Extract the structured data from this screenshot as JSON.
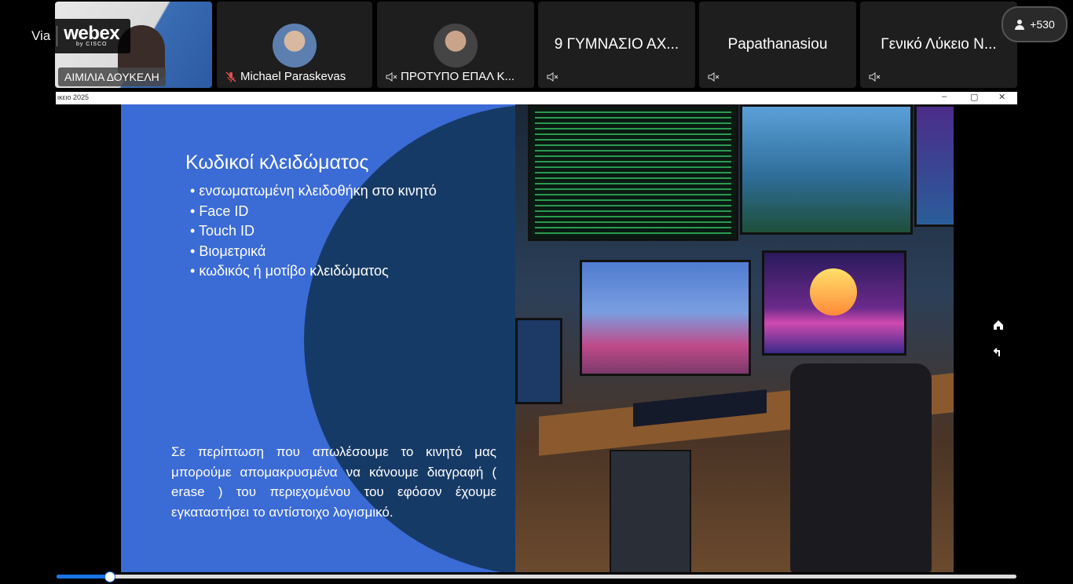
{
  "webex": {
    "via": "Via",
    "brand": "webex",
    "sub": "by CISCO"
  },
  "participants": [
    {
      "name": "ΑΙΜΙΛΙΑ ΔΟΥΚΕΛΗ"
    },
    {
      "name": "Michael Paraskevas"
    },
    {
      "name": "ΠΡΟΤΥΠΟ ΕΠΑΛ Κ..."
    },
    {
      "name": "9 ΓΥΜΝΑΣΙΟ ΑΧ..."
    },
    {
      "name": "Papathanasiou"
    },
    {
      "name": "Γενικό Λύκειο Ν..."
    }
  ],
  "participant_count": "+530",
  "window": {
    "title": "ικειο 2025",
    "minimize": "–",
    "restore": "▢",
    "close": "✕"
  },
  "slide": {
    "title": "Κωδικοί κλειδώματος",
    "bullets": [
      "ενσωματωμένη κλειδοθήκη στο κινητό",
      "Face ID",
      "Touch ID",
      "Βιομετρικά",
      "κωδικός ή μοτίβο κλειδώματος"
    ],
    "paragraph": "Σε περίπτωση που απωλέσουμε το κινητό μας μπορούμε απομακρυσμένα να κάνουμε διαγραφή ( erase ) του περιεχομένου του εφόσον έχουμε εγκαταστήσει το αντίστοιχο λογισμικό."
  },
  "progress": {
    "fraction": 0.055
  },
  "colors": {
    "slide_bg": "#3b6bd4",
    "circle": "#163a66",
    "accent": "#1a73e8"
  }
}
